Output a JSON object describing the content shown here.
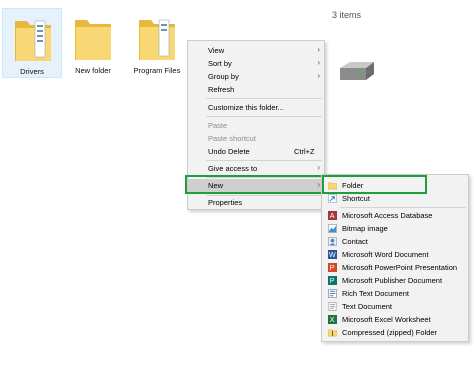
{
  "explorer": {
    "items_count": "3 items",
    "folders": [
      {
        "label": "Drivers"
      },
      {
        "label": "New folder"
      },
      {
        "label": "Program Files"
      }
    ]
  },
  "context_menu": {
    "items": [
      {
        "label": "View"
      },
      {
        "label": "Sort by"
      },
      {
        "label": "Group by"
      },
      {
        "label": "Refresh"
      },
      {
        "label": "Customize this folder..."
      },
      {
        "label": "Paste"
      },
      {
        "label": "Paste shortcut"
      },
      {
        "label": "Undo Delete",
        "shortcut": "Ctrl+Z"
      },
      {
        "label": "Give access to"
      },
      {
        "label": "New"
      },
      {
        "label": "Properties"
      }
    ]
  },
  "new_submenu": {
    "items": [
      {
        "label": "Folder",
        "icon": "folder-icon"
      },
      {
        "label": "Shortcut",
        "icon": "shortcut-icon"
      },
      {
        "label": "Microsoft Access Database",
        "icon": "access-icon"
      },
      {
        "label": "Bitmap image",
        "icon": "bitmap-icon"
      },
      {
        "label": "Contact",
        "icon": "contact-icon"
      },
      {
        "label": "Microsoft Word Document",
        "icon": "word-icon"
      },
      {
        "label": "Microsoft PowerPoint Presentation",
        "icon": "powerpoint-icon"
      },
      {
        "label": "Microsoft Publisher Document",
        "icon": "publisher-icon"
      },
      {
        "label": "Rich Text Document",
        "icon": "rtf-icon"
      },
      {
        "label": "Text Document",
        "icon": "text-icon"
      },
      {
        "label": "Microsoft Excel Worksheet",
        "icon": "excel-icon"
      },
      {
        "label": "Compressed (zipped) Folder",
        "icon": "zip-icon"
      }
    ]
  },
  "colors": {
    "highlight": "#1e9e3c",
    "folder_yellow": "#f8d775",
    "selection": "#e5f1fb"
  }
}
